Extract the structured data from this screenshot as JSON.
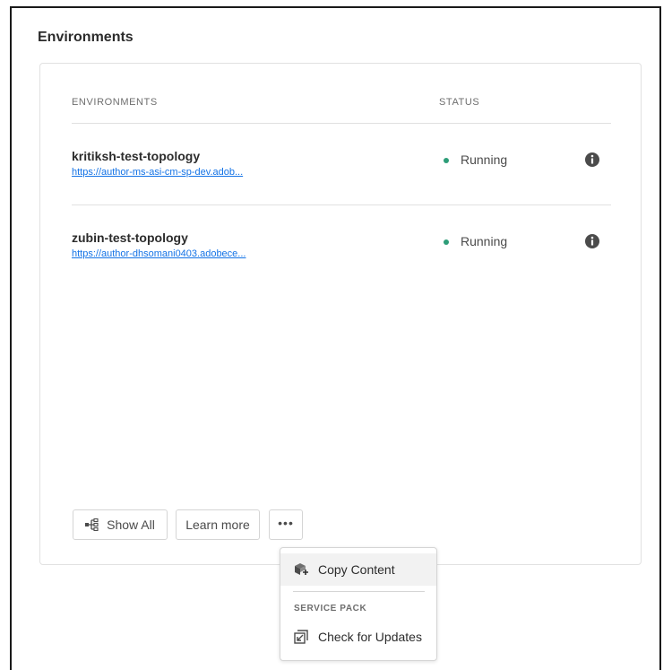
{
  "section": {
    "title": "Environments"
  },
  "table": {
    "headers": {
      "environments": "ENVIRONMENTS",
      "status": "STATUS"
    },
    "rows": [
      {
        "name": "kritiksh-test-topology",
        "url": "https://author-ms-asi-cm-sp-dev.adob...",
        "status": "Running",
        "status_color": "#2d9d78"
      },
      {
        "name": "zubin-test-topology",
        "url": "https://author-dhsomani0403.adobece...",
        "status": "Running",
        "status_color": "#2d9d78"
      }
    ]
  },
  "actions": {
    "show_all": "Show All",
    "learn_more": "Learn more",
    "more": "•••"
  },
  "menu": {
    "copy_content": "Copy Content",
    "section_label": "SERVICE PACK",
    "check_updates": "Check for Updates"
  },
  "icons": {
    "info": "info-icon",
    "show_all": "tree-icon",
    "copy_content": "copy-content-icon",
    "check_updates": "check-updates-icon"
  },
  "colors": {
    "link": "#1473e6",
    "running": "#2d9d78",
    "menu_highlight": "#f2f2f2"
  }
}
